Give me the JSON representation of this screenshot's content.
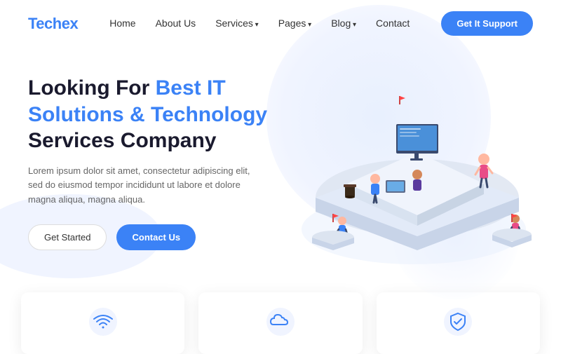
{
  "logo": {
    "prefix": "Tech",
    "suffix": "ex"
  },
  "nav": {
    "links": [
      {
        "label": "Home",
        "has_dropdown": false
      },
      {
        "label": "About Us",
        "has_dropdown": false
      },
      {
        "label": "Services",
        "has_dropdown": true
      },
      {
        "label": "Pages",
        "has_dropdown": true
      },
      {
        "label": "Blog",
        "has_dropdown": true
      },
      {
        "label": "Contact",
        "has_dropdown": false
      }
    ],
    "cta_button": "Get It Support"
  },
  "hero": {
    "title_line1": "Looking For ",
    "title_highlight": "Best IT",
    "title_line2": "Solutions & Technology",
    "title_line3": "Services Company",
    "subtitle": "Lorem ipsum dolor sit amet, consectetur adipiscing elit, sed do eiusmod tempor incididunt ut labore et dolore magna aliqua, magna aliqua.",
    "btn_get_started": "Get Started",
    "btn_contact": "Contact Us"
  },
  "cards": [
    {
      "icon": "wifi-icon"
    },
    {
      "icon": "cloud-icon"
    },
    {
      "icon": "shield-icon"
    }
  ]
}
